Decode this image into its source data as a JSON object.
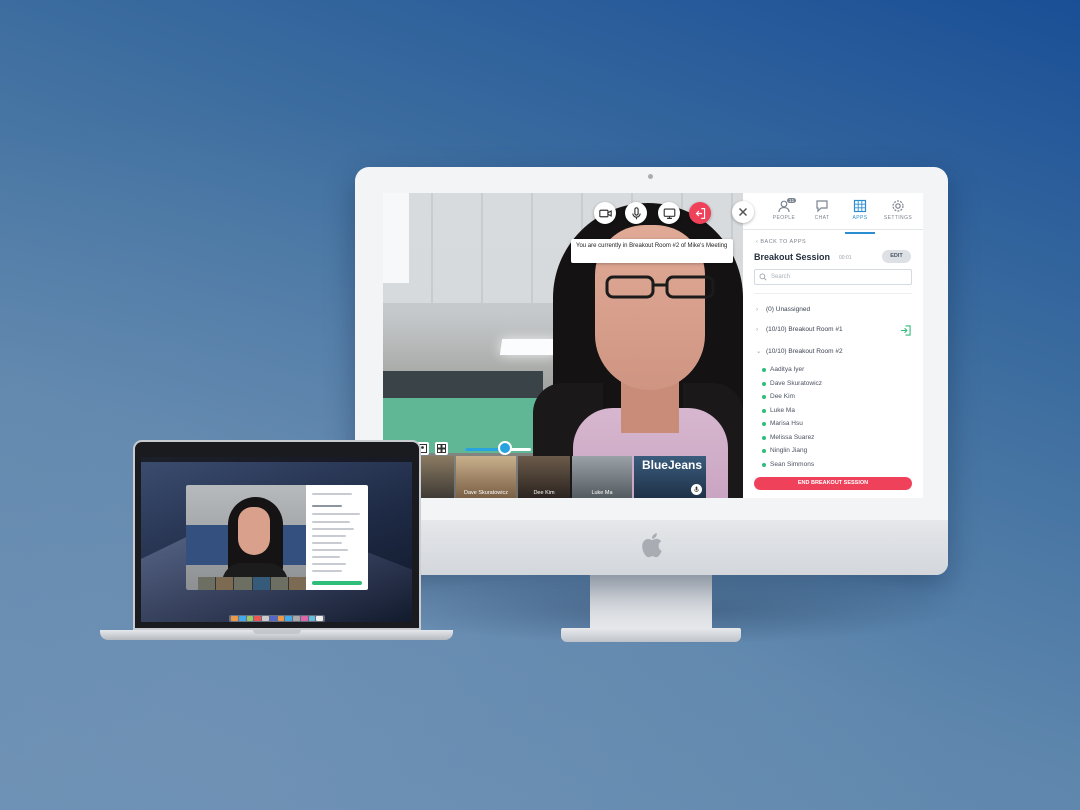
{
  "tooltip": {
    "text": "You are currently in Breakout Room #2 of Mike's Meeting"
  },
  "controls": [
    "video-camera-icon",
    "microphone-icon",
    "screen-share-icon",
    "leave-icon",
    "close-icon"
  ],
  "tabs": [
    {
      "label": "PEOPLE",
      "badge": "11",
      "icon": "people-icon"
    },
    {
      "label": "CHAT",
      "icon": "chat-icon"
    },
    {
      "label": "APPS",
      "icon": "apps-grid-icon",
      "active": true
    },
    {
      "label": "SETTINGS",
      "icon": "gear-icon"
    }
  ],
  "sidebar": {
    "back_label": "BACK TO APPS",
    "title": "Breakout Session",
    "timer": "00:01",
    "edit_label": "EDIT",
    "search_placeholder": "Search",
    "rooms": [
      {
        "label": "(0) Unassigned",
        "expanded": false
      },
      {
        "label": "(10/10) Breakout Room #1",
        "expanded": false,
        "join": true
      },
      {
        "label": "(10/10) Breakout Room #2",
        "expanded": true
      }
    ],
    "members": [
      "Aaditya Iyer",
      "Dave Skuratowicz",
      "Dee Kim",
      "Luke Ma",
      "Marisa Hsu",
      "Melissa Suarez",
      "Ninglin Jiang",
      "Sean Simmons"
    ],
    "end_label": "END BREAKOUT SESSION"
  },
  "filmstrip": [
    {
      "name": "Dave Skuratowicz"
    },
    {
      "name": "Dee Kim"
    },
    {
      "name": "Luke Ma"
    },
    {
      "name": "",
      "logo": "BlueJeans"
    }
  ],
  "colors": {
    "accent": "#2b8ed3",
    "danger": "#f0415b",
    "online": "#2fbd7a"
  }
}
